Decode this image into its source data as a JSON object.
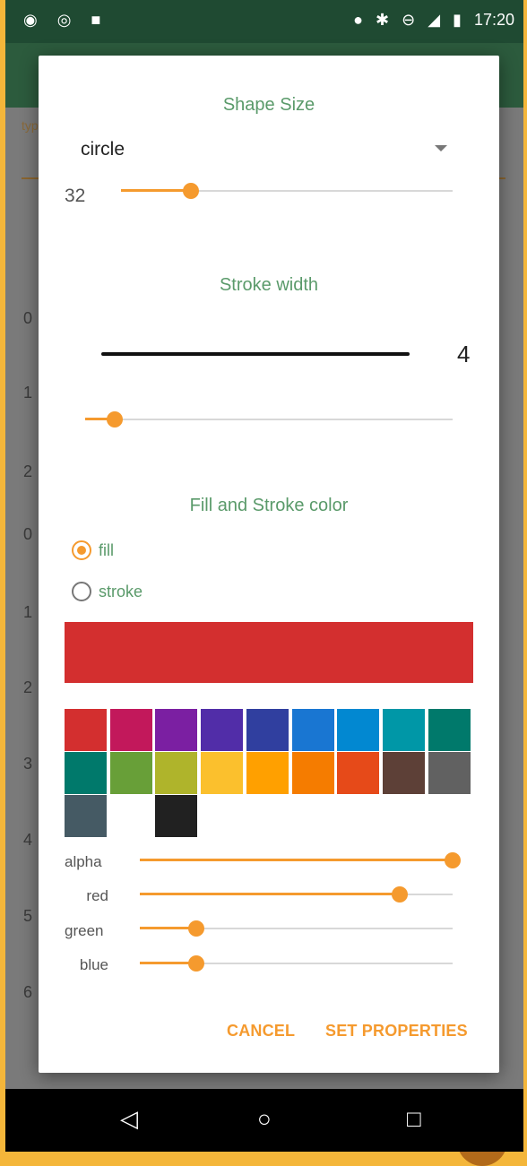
{
  "status_bar": {
    "time": "17:20",
    "left_icons": [
      "camera-icon",
      "wifi-signal-icon",
      "android-icon"
    ],
    "right_icons": [
      "location-icon",
      "bluetooth-icon",
      "do-not-disturb-icon",
      "signal-icon",
      "battery-icon"
    ]
  },
  "background": {
    "type_label": "typ",
    "row_numbers": [
      "0",
      "1",
      "2",
      "0",
      "1",
      "2",
      "3",
      "4",
      "5",
      "6"
    ]
  },
  "dialog": {
    "shape_size_title": "Shape Size",
    "shape_selected": "circle",
    "size_value": "32",
    "size_slider_fraction": 0.21,
    "stroke_width_title": "Stroke width",
    "stroke_value": "4",
    "stroke_slider_fraction": 0.08,
    "color_title": "Fill and Stroke color",
    "fill_label": "fill",
    "stroke_label": "stroke",
    "fill_selected": true,
    "preview_color": "#d32f2f",
    "palette": [
      "#d32f2f",
      "#c2185b",
      "#7b1fa2",
      "#512da8",
      "#303f9f",
      "#1976d2",
      "#0288d1",
      "#0097a7",
      "#00796b",
      "#00796b",
      "#689f38",
      "#afb42b",
      "#fbc02d",
      "#ffa000",
      "#f57c00",
      "#e64a19",
      "#5d4037",
      "#616161",
      "#455a64",
      "",
      "#212121"
    ],
    "alpha_label": "alpha",
    "red_label": "red",
    "green_label": "green",
    "blue_label": "blue",
    "alpha_fraction": 1.0,
    "red_fraction": 0.83,
    "green_fraction": 0.18,
    "blue_fraction": 0.18,
    "cancel_label": "CANCEL",
    "set_label": "SET PROPERTIES"
  },
  "colors": {
    "accent": "#f59a2e",
    "title_green": "#5a9a6a"
  },
  "nav_bar": {
    "back": "◁",
    "home": "○",
    "recents": "□"
  }
}
